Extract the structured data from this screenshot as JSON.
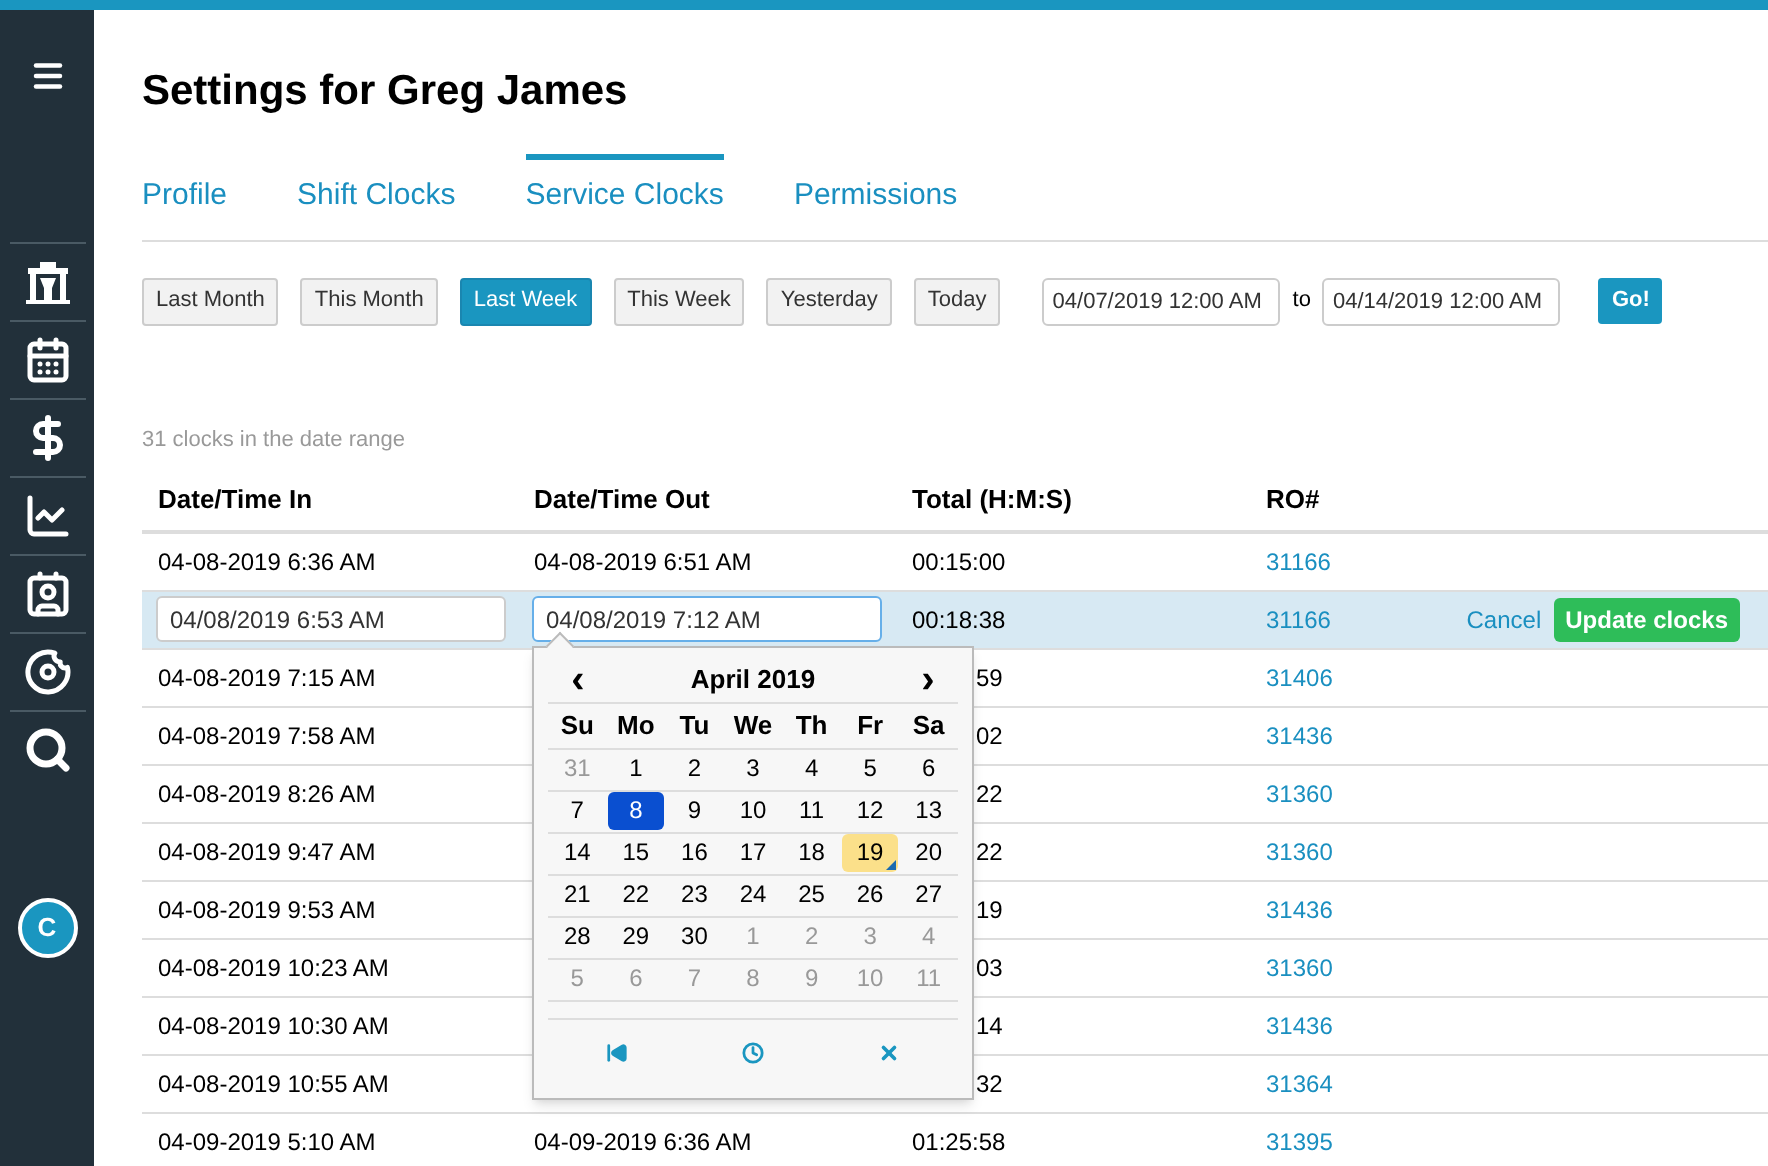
{
  "title": "Settings for Greg James",
  "tabs": [
    {
      "label": "Profile",
      "selected": false
    },
    {
      "label": "Shift Clocks",
      "selected": false
    },
    {
      "label": "Service Clocks",
      "selected": true
    },
    {
      "label": "Permissions",
      "selected": false
    }
  ],
  "ranges": [
    {
      "label": "Last Month",
      "selected": false
    },
    {
      "label": "This Month",
      "selected": false
    },
    {
      "label": "Last Week",
      "selected": true
    },
    {
      "label": "This Week",
      "selected": false
    },
    {
      "label": "Yesterday",
      "selected": false
    },
    {
      "label": "Today",
      "selected": false
    }
  ],
  "from": "04/07/2019 12:00 AM",
  "to_label": "to",
  "to": "04/14/2019 12:00 AM",
  "go": "Go!",
  "count": "31 clocks in the date range",
  "columns": [
    "Date/Time In",
    "Date/Time Out",
    "Total (H:M:S)",
    "RO#"
  ],
  "rows": [
    {
      "in": "04-08-2019 6:36 AM",
      "out": "04-08-2019 6:51 AM",
      "total": "00:15:00",
      "ro": "31166"
    },
    {
      "editing": true,
      "in": "04/08/2019 6:53 AM",
      "out": "04/08/2019 7:12 AM",
      "total": "00:18:38",
      "ro": "31166",
      "cancel": "Cancel",
      "update": "Update clocks"
    },
    {
      "in": "04-08-2019 7:15 AM",
      "total": "59",
      "ro": "31406"
    },
    {
      "in": "04-08-2019 7:58 AM",
      "total": "02",
      "ro": "31436"
    },
    {
      "in": "04-08-2019 8:26 AM",
      "total": "22",
      "ro": "31360"
    },
    {
      "in": "04-08-2019 9:47 AM",
      "total": "22",
      "ro": "31360"
    },
    {
      "in": "04-08-2019 9:53 AM",
      "total": "19",
      "ro": "31436"
    },
    {
      "in": "04-08-2019 10:23 AM",
      "total": "03",
      "ro": "31360"
    },
    {
      "in": "04-08-2019 10:30 AM",
      "total": "14",
      "ro": "31436"
    },
    {
      "in": "04-08-2019 10:55 AM",
      "total": "32",
      "ro": "31364"
    },
    {
      "in": "04-09-2019 5:10 AM",
      "out": "04-09-2019 6:36 AM",
      "total": "01:25:58",
      "ro": "31395"
    }
  ],
  "calendar": {
    "prev": "‹",
    "month": "April 2019",
    "next": "›",
    "weekdays": [
      "Su",
      "Mo",
      "Tu",
      "We",
      "Th",
      "Fr",
      "Sa"
    ],
    "days": [
      {
        "label": "31",
        "kind": "other",
        "selected": false,
        "highlighted": false
      },
      {
        "label": "1",
        "kind": "current",
        "selected": false,
        "highlighted": false
      },
      {
        "label": "2",
        "kind": "current",
        "selected": false,
        "highlighted": false
      },
      {
        "label": "3",
        "kind": "current",
        "selected": false,
        "highlighted": false
      },
      {
        "label": "4",
        "kind": "current",
        "selected": false,
        "highlighted": false
      },
      {
        "label": "5",
        "kind": "current",
        "selected": false,
        "highlighted": false
      },
      {
        "label": "6",
        "kind": "current",
        "selected": false,
        "highlighted": false
      },
      {
        "label": "7",
        "kind": "current",
        "selected": false,
        "highlighted": false
      },
      {
        "label": "8",
        "kind": "current",
        "selected": true,
        "highlighted": false
      },
      {
        "label": "9",
        "kind": "current",
        "selected": false,
        "highlighted": false
      },
      {
        "label": "10",
        "kind": "current",
        "selected": false,
        "highlighted": false
      },
      {
        "label": "11",
        "kind": "current",
        "selected": false,
        "highlighted": false
      },
      {
        "label": "12",
        "kind": "current",
        "selected": false,
        "highlighted": false
      },
      {
        "label": "13",
        "kind": "current",
        "selected": false,
        "highlighted": false
      },
      {
        "label": "14",
        "kind": "current",
        "selected": false,
        "highlighted": false
      },
      {
        "label": "15",
        "kind": "current",
        "selected": false,
        "highlighted": false
      },
      {
        "label": "16",
        "kind": "current",
        "selected": false,
        "highlighted": false
      },
      {
        "label": "17",
        "kind": "current",
        "selected": false,
        "highlighted": false
      },
      {
        "label": "18",
        "kind": "current",
        "selected": false,
        "highlighted": false
      },
      {
        "label": "19",
        "kind": "current",
        "selected": false,
        "highlighted": true
      },
      {
        "label": "20",
        "kind": "current",
        "selected": false,
        "highlighted": false
      },
      {
        "label": "21",
        "kind": "current",
        "selected": false,
        "highlighted": false
      },
      {
        "label": "22",
        "kind": "current",
        "selected": false,
        "highlighted": false
      },
      {
        "label": "23",
        "kind": "current",
        "selected": false,
        "highlighted": false
      },
      {
        "label": "24",
        "kind": "current",
        "selected": false,
        "highlighted": false
      },
      {
        "label": "25",
        "kind": "current",
        "selected": false,
        "highlighted": false
      },
      {
        "label": "26",
        "kind": "current",
        "selected": false,
        "highlighted": false
      },
      {
        "label": "27",
        "kind": "current",
        "selected": false,
        "highlighted": false
      },
      {
        "label": "28",
        "kind": "current",
        "selected": false,
        "highlighted": false
      },
      {
        "label": "29",
        "kind": "current",
        "selected": false,
        "highlighted": false
      },
      {
        "label": "30",
        "kind": "current",
        "selected": false,
        "highlighted": false
      },
      {
        "label": "1",
        "kind": "other",
        "selected": false,
        "highlighted": false
      },
      {
        "label": "2",
        "kind": "other",
        "selected": false,
        "highlighted": false
      },
      {
        "label": "3",
        "kind": "other",
        "selected": false,
        "highlighted": false
      },
      {
        "label": "4",
        "kind": "other",
        "selected": false,
        "highlighted": false
      },
      {
        "label": "5",
        "kind": "other",
        "selected": false,
        "highlighted": false
      },
      {
        "label": "6",
        "kind": "other",
        "selected": false,
        "highlighted": false
      },
      {
        "label": "7",
        "kind": "other",
        "selected": false,
        "highlighted": false
      },
      {
        "label": "8",
        "kind": "other",
        "selected": false,
        "highlighted": false
      },
      {
        "label": "9",
        "kind": "other",
        "selected": false,
        "highlighted": false
      },
      {
        "label": "10",
        "kind": "other",
        "selected": false,
        "highlighted": false
      },
      {
        "label": "11",
        "kind": "other",
        "selected": false,
        "highlighted": false
      }
    ]
  },
  "avatar": "C"
}
